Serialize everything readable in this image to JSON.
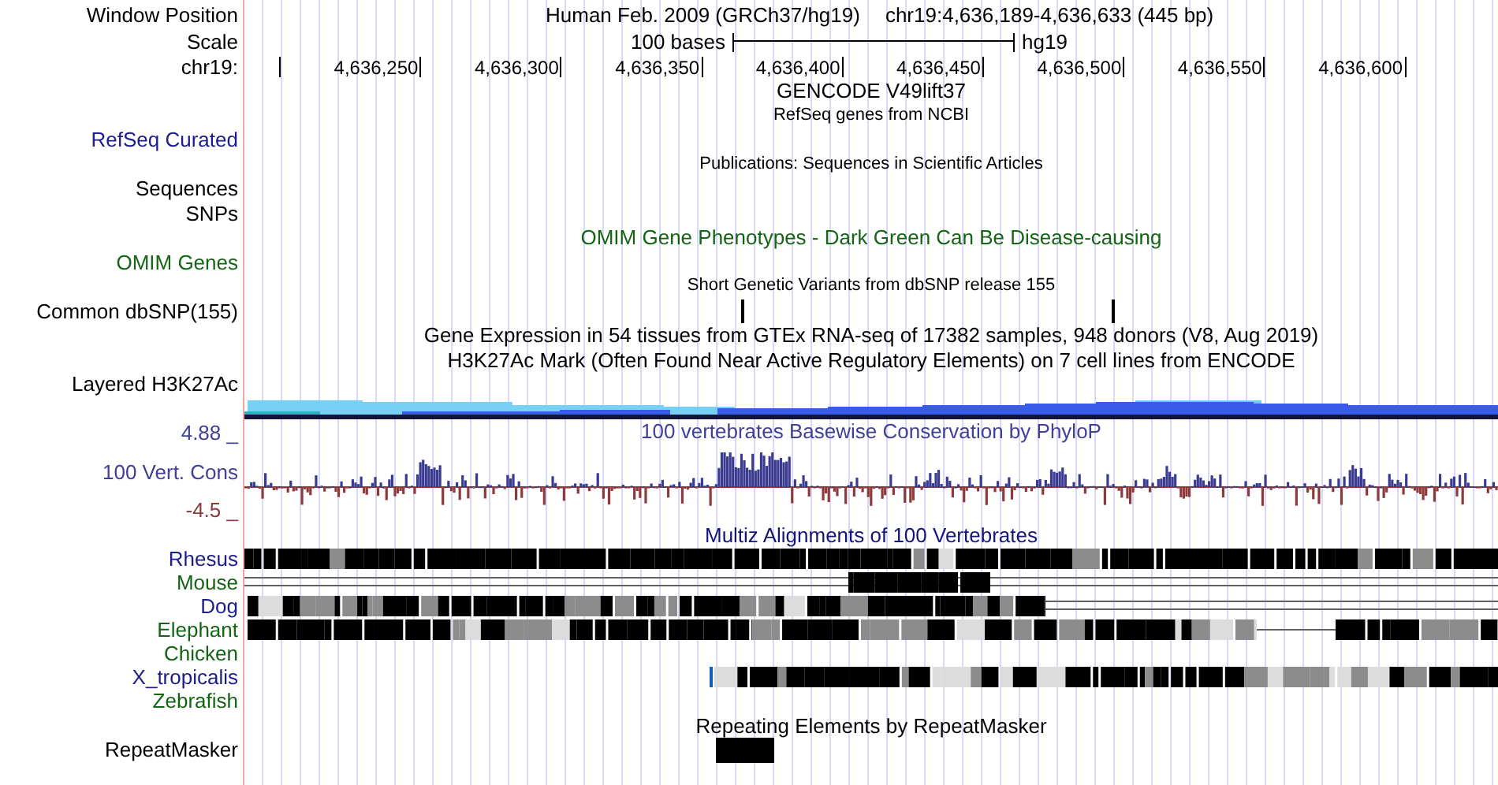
{
  "header": {
    "position_label": "Window Position",
    "assembly": "Human Feb. 2009 (GRCh37/hg19)",
    "position": "chr19:4,636,189-4,636,633 (445 bp)",
    "scale_label": "Scale",
    "scale_text": "100 bases",
    "scale_db": "hg19",
    "chrom_label": "chr19:",
    "ruler": [
      "4,636,250",
      "4,636,300",
      "4,636,350",
      "4,636,400",
      "4,636,450",
      "4,636,500",
      "4,636,550",
      "4,636,600"
    ]
  },
  "rows": [
    {
      "kind": "title",
      "text": "GENCODE V49lift37",
      "color": "#000000"
    },
    {
      "kind": "subtitle",
      "text": "RefSeq genes from NCBI",
      "color": "#000000"
    },
    {
      "kind": "label",
      "text": "RefSeq Curated",
      "color": "#1c1c8c"
    },
    {
      "kind": "subtitle",
      "text": "Publications: Sequences in Scientific Articles",
      "color": "#000000"
    },
    {
      "kind": "label",
      "text": "Sequences",
      "color": "#000000"
    },
    {
      "kind": "label",
      "text": "SNPs",
      "color": "#000000"
    },
    {
      "kind": "title",
      "text": "OMIM Gene Phenotypes - Dark Green Can Be Disease-causing",
      "color": "#146414"
    },
    {
      "kind": "label",
      "text": "OMIM Genes",
      "color": "#146414"
    },
    {
      "kind": "subtitle",
      "text": "Short Genetic Variants from dbSNP release 155",
      "color": "#000000"
    },
    {
      "kind": "variants",
      "text": "Common dbSNP(155)",
      "color": "#000000"
    },
    {
      "kind": "title",
      "text": "Gene Expression in 54 tissues from GTEx RNA-seq of 17382 samples, 948 donors (V8, Aug 2019)",
      "color": "#000000"
    },
    {
      "kind": "title",
      "text": "H3K27Ac Mark (Often Found Near Active Regulatory Elements) on 7 cell lines from ENCODE",
      "color": "#000000"
    }
  ],
  "h3k27ac": {
    "label": "Layered H3K27Ac"
  },
  "phylop": {
    "title": "100 vertebrates Basewise Conservation by PhyloP",
    "max_label": "4.88 _",
    "label": "100 Vert. Cons",
    "min_label": "-4.5 _"
  },
  "multiz": {
    "title": "Multiz Alignments of 100 Vertebrates",
    "species": [
      {
        "name": "Rhesus",
        "color": "#1c1c8c"
      },
      {
        "name": "Mouse",
        "color": "#146414"
      },
      {
        "name": "Dog",
        "color": "#1c1c8c"
      },
      {
        "name": "Elephant",
        "color": "#146414"
      },
      {
        "name": "Chicken",
        "color": "#146414"
      },
      {
        "name": "X_tropicalis",
        "color": "#1c1c8c"
      },
      {
        "name": "Zebrafish",
        "color": "#146414"
      }
    ]
  },
  "repeatmasker": {
    "title": "Repeating Elements by RepeatMasker",
    "label": "RepeatMasker"
  }
}
